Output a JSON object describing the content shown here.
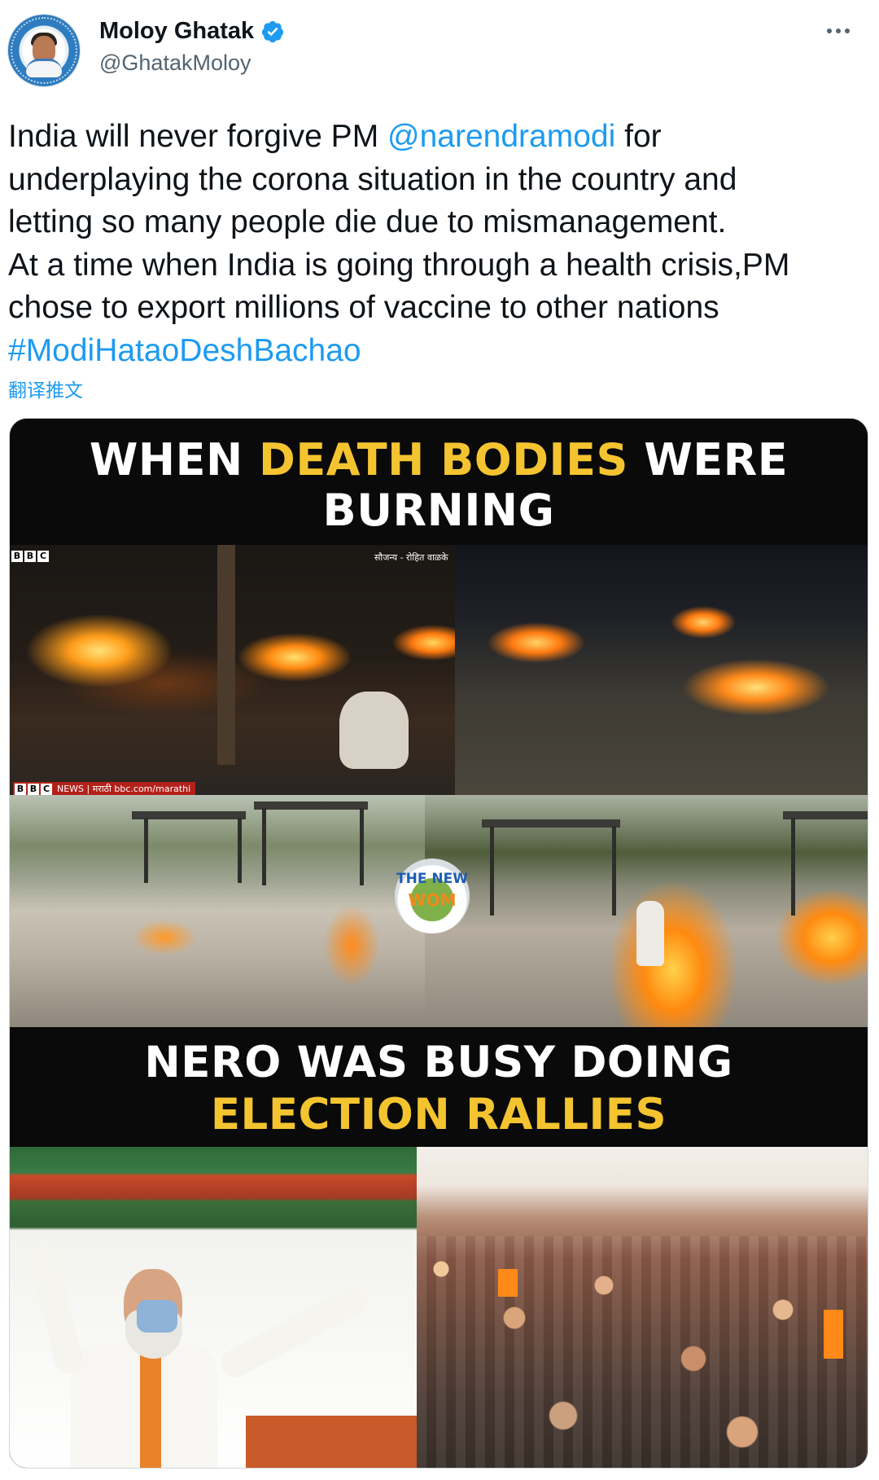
{
  "header": {
    "display_name": "Moloy Ghatak",
    "handle": "@GhatakMoloy",
    "verified": true,
    "more_icon": "ellipsis-icon"
  },
  "tweet": {
    "line1_pre": "India will never forgive PM ",
    "mention": "@narendramodi",
    "line1_post": " for",
    "line2": "underplaying the corona situation in the country and",
    "line3": "letting so many people die due to mismanagement.",
    "line4": "At a time when India is going through a health crisis,PM",
    "line5": "chose to export millions of vaccine to other nations",
    "hashtag": "#ModiHataoDeshBachao",
    "translate_label": "翻译推文"
  },
  "media": {
    "caption_top_white1": "WHEN ",
    "caption_top_yellow": "DEATH BODIES",
    "caption_top_white2": " WERE",
    "caption_top_line2": "BURNING",
    "caption_mid_line1": "NERO WAS BUSY DOING",
    "caption_mid_line2": "ELECTION RALLIES",
    "bbc_letters": [
      "B",
      "B",
      "C"
    ],
    "bbc_bottom": "NEWS | मराठी   bbc.com/marathi",
    "credit": "सौजन्य - रोहित वाळके",
    "watermark_line1": "THE NEW",
    "watermark_line2": "WOM"
  },
  "colors": {
    "link": "#1d9bf0",
    "caption_yellow": "#f4c430",
    "secondary_text": "#536471"
  }
}
